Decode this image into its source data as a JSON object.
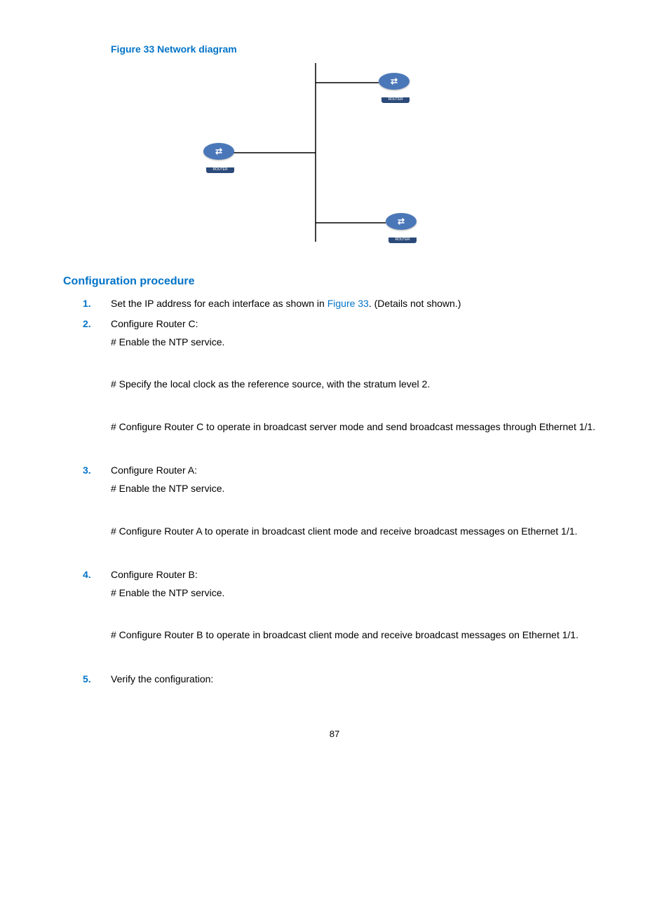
{
  "figure": {
    "caption": "Figure 33 Network diagram",
    "router_icon_label": "ROUTER"
  },
  "section_heading": "Configuration procedure",
  "steps": [
    {
      "num": "1.",
      "lines": [
        {
          "pre": "Set the IP address for each interface as shown in ",
          "link": "Figure 33",
          "post": ". (Details not shown.)"
        }
      ]
    },
    {
      "num": "2.",
      "lines": [
        {
          "text": "Configure Router C:"
        },
        {
          "text": "# Enable the NTP service."
        },
        {
          "spacer": true
        },
        {
          "text": "# Specify the local clock as the reference source, with the stratum level 2."
        },
        {
          "spacer": true
        },
        {
          "text": "# Configure Router C to operate in broadcast server mode and send broadcast messages through Ethernet 1/1."
        },
        {
          "spacer": true
        }
      ]
    },
    {
      "num": "3.",
      "lines": [
        {
          "text": "Configure Router A:"
        },
        {
          "text": "# Enable the NTP service."
        },
        {
          "spacer": true
        },
        {
          "text": "# Configure Router A to operate in broadcast client mode and receive broadcast messages on Ethernet 1/1."
        },
        {
          "spacer": true
        }
      ]
    },
    {
      "num": "4.",
      "lines": [
        {
          "text": "Configure Router B:"
        },
        {
          "text": "# Enable the NTP service."
        },
        {
          "spacer": true
        },
        {
          "text": "# Configure Router B to operate in broadcast client mode and receive broadcast messages on Ethernet 1/1."
        },
        {
          "spacer": true
        }
      ]
    },
    {
      "num": "5.",
      "lines": [
        {
          "text": "Verify the configuration:"
        }
      ]
    }
  ],
  "page_number": "87"
}
